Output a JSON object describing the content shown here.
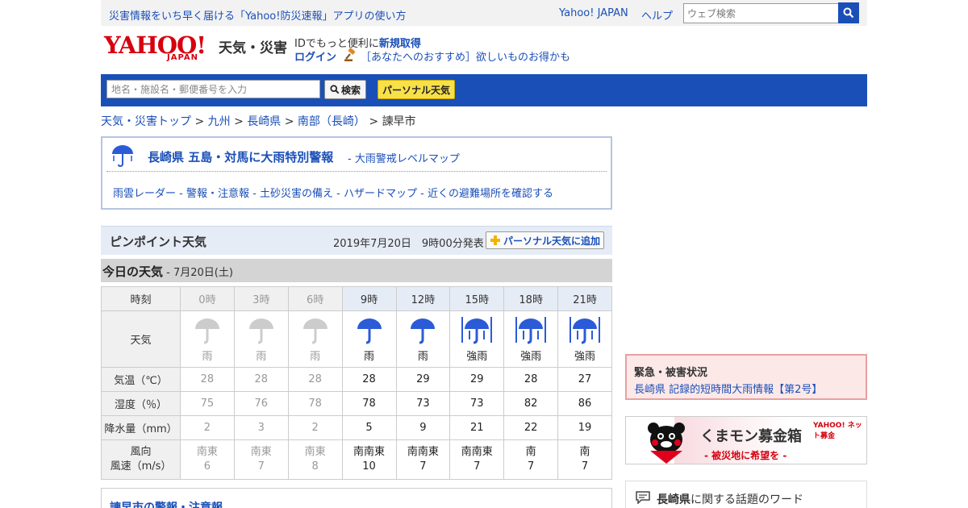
{
  "topbar": {
    "notice": "災害情報をいち早く届ける「Yahoo!防災速報」アプリの使い方",
    "yahoo_japan": "Yahoo! JAPAN",
    "help": "ヘルプ",
    "search_placeholder": "ウェブ検索"
  },
  "header": {
    "logo_text": "YAHOO!",
    "logo_sub": "JAPAN",
    "service_name": "天気・災害",
    "id_prefix": "IDでもっと便利に",
    "id_link": "新規取得",
    "login": "ログイン",
    "promo": "［あなたへのおすすめ］欲しいものお得かも"
  },
  "locbar": {
    "placeholder": "地名・施設名・郵便番号を入力",
    "search_btn": "検索",
    "personal_btn": "パーソナル天気"
  },
  "breadcrumb": {
    "items": [
      "天気・災害トップ",
      "九州",
      "長崎県",
      "南部（長崎）"
    ],
    "sep": " > ",
    "current": "諫早市"
  },
  "alert": {
    "headline": "長崎県 五島・対馬に大雨特別警報",
    "map_link": "- 大雨警戒レベルマップ",
    "links": [
      "雨雲レーダー",
      "警報・注意報",
      "土砂災害の備え",
      "ハザードマップ",
      "近くの避難場所を確認する"
    ],
    "link_sep": " - "
  },
  "pinpoint": {
    "title": "ピンポイント天気",
    "date": "2019年7月20日　9時00分発表",
    "add_btn": "パーソナル天気に追加"
  },
  "today": {
    "title": "今日の天気",
    "date": " - 7月20日(土)"
  },
  "table": {
    "labels": {
      "time": "時刻",
      "weather": "天気",
      "temp": "気温（℃）",
      "humidity": "湿度（％）",
      "precip": "降水量（mm）",
      "wind_dir": "風向",
      "wind_speed": "風速（m/s）"
    },
    "hours": [
      "0時",
      "3時",
      "6時",
      "9時",
      "12時",
      "15時",
      "18時",
      "21時"
    ],
    "weather": [
      "雨",
      "雨",
      "雨",
      "雨",
      "雨",
      "強雨",
      "強雨",
      "強雨"
    ],
    "temp": [
      "28",
      "28",
      "28",
      "28",
      "29",
      "29",
      "28",
      "27"
    ],
    "humidity": [
      "75",
      "76",
      "78",
      "78",
      "73",
      "73",
      "82",
      "86"
    ],
    "precip": [
      "2",
      "3",
      "2",
      "5",
      "9",
      "21",
      "22",
      "19"
    ],
    "wind_dir": [
      "南東",
      "南東",
      "南東",
      "南南東",
      "南南東",
      "南南東",
      "南",
      "南"
    ],
    "wind_speed": [
      "6",
      "7",
      "8",
      "10",
      "7",
      "7",
      "7",
      "7"
    ],
    "past_color": "#999999",
    "icon_color_past": "#cccccc",
    "icon_color_cur": "#2b5bd7"
  },
  "warnings_box": {
    "title": "諫早市の警報・注意報"
  },
  "emergency": {
    "title": "緊急・被害状況",
    "link": "長崎県 記録的短時間大雨情報【第2号】"
  },
  "kumamon": {
    "main": "くまモン募金箱",
    "sub": "- 被災地に希望を -",
    "brand": "YAHOO! ネット募金"
  },
  "topics": {
    "pref": "長崎県",
    "suffix": "に関する話題のワード"
  }
}
